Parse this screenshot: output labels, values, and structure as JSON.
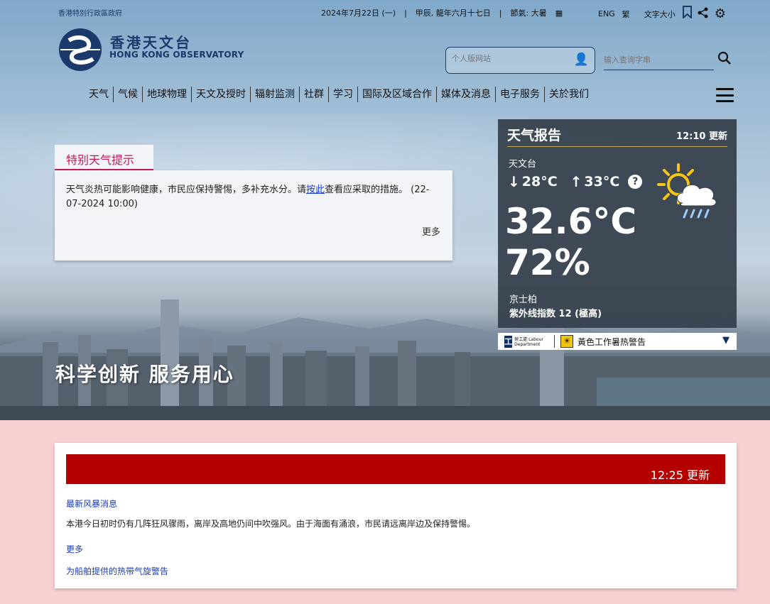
{
  "gov_link": "香港特別行政區政府",
  "topbar": {
    "date": "2024年7月22日 (一)",
    "lunar": "甲辰, 龍年六月十七日",
    "solar_term": "節氣: 大暑",
    "lang": "ENG",
    "trad": "繁",
    "font_size": "文字大小"
  },
  "logo": {
    "zh": "香港天文台",
    "en": "HONG KONG OBSERVATORY"
  },
  "search": {
    "personal_placeholder": "个人版网站",
    "query_placeholder": "输入查询字串"
  },
  "nav": [
    "天气",
    "气候",
    "地球物理",
    "天文及授时",
    "辐射监测",
    "社群",
    "学习",
    "国际及区域合作",
    "媒体及消息",
    "电子服务",
    "关於我们"
  ],
  "tip": {
    "tab": "特别天气提示",
    "text_before": "天气炎热可能影响健康，市民应保持警惕，多补充水分。请",
    "link": "按此",
    "text_after": "查看应采取的措施。 (22-07-2024 10:00)",
    "more": "更多"
  },
  "weather": {
    "title": "天气报告",
    "updated": "12:10 更新",
    "station": "天文台",
    "min": "28°C",
    "max": "33°C",
    "temp": "32.6°C",
    "humidity": "72%",
    "uv_station": "京士柏",
    "uv": "紫外线指数 12 (極高)"
  },
  "warning": {
    "labour_logo": "勞工處 Labour Department",
    "text": "黃色工作暑热警告"
  },
  "slogan": "科学创新 服务用心",
  "panel": {
    "updated": "12:25 更新",
    "link1": "最新风暴消息",
    "text": "本港今日初时仍有几阵狂风骤雨，离岸及高地仍间中吹强风。由于海面有涌浪，市民请远离岸边及保持警惕。",
    "more": "更多",
    "link2": "为船舶提供的热带气旋警告"
  },
  "colors": {
    "brand": "#1b3a6b",
    "tip_accent": "#c2185b",
    "alert_red": "#b50000",
    "bg_pink": "#f8d0d2"
  }
}
